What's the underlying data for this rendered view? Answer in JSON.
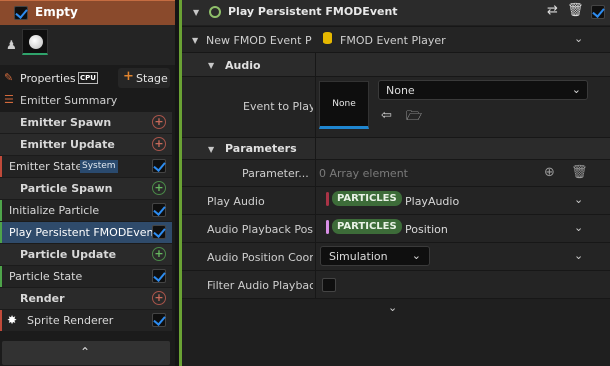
{
  "stack": {
    "title": "Empty",
    "enabled": true,
    "tabs": {
      "properties": "Properties",
      "cpu_badge": "CPU",
      "stage": "Stage"
    },
    "items": [
      {
        "type": "summary",
        "label": "Emitter Summary"
      },
      {
        "type": "section",
        "label": "Emitter Spawn",
        "add": "red"
      },
      {
        "type": "section",
        "label": "Emitter Update",
        "add": "red"
      },
      {
        "type": "module",
        "label": "Emitter State",
        "badge": "System",
        "bar": "#c04a3a"
      },
      {
        "type": "section",
        "label": "Particle Spawn",
        "add": "green"
      },
      {
        "type": "module",
        "label": "Initialize Particle",
        "bar": "#4ea44a"
      },
      {
        "type": "module",
        "label": "Play Persistent FMODEvent",
        "bar": "#4ea44a",
        "selected": true
      },
      {
        "type": "section",
        "label": "Particle Update",
        "add": "green"
      },
      {
        "type": "module",
        "label": "Particle State",
        "bar": "#4ea44a"
      },
      {
        "type": "section",
        "label": "Render",
        "add": "red"
      },
      {
        "type": "module",
        "label": "Sprite Renderer",
        "bar": "#c04a3a",
        "icon": "sparkle-icon"
      }
    ]
  },
  "details": {
    "title": "Play Persistent FMODEvent",
    "new_fmod_label": "New FMOD Event Pl",
    "new_fmod_value": "FMOD Event Player",
    "audio_category": "Audio",
    "event_to_play_label": "Event to Play",
    "asset_thumb_text": "None",
    "event_combo_value": "None",
    "parameters_category": "Parameters",
    "parameters_label": "Parameter...",
    "parameters_value": "0 Array element",
    "play_audio_label": "Play Audio",
    "play_audio_badge": "PARTICLES",
    "play_audio_value": "PlayAudio",
    "audio_playback_pos_label": "Audio Playback Posi",
    "audio_playback_pos_badge": "PARTICLES",
    "audio_playback_pos_value": "Position",
    "audio_position_coord_label": "Audio Position Coord",
    "audio_position_coord_value": "Simulation",
    "filter_audio_label": "Filter Audio Playbac"
  }
}
